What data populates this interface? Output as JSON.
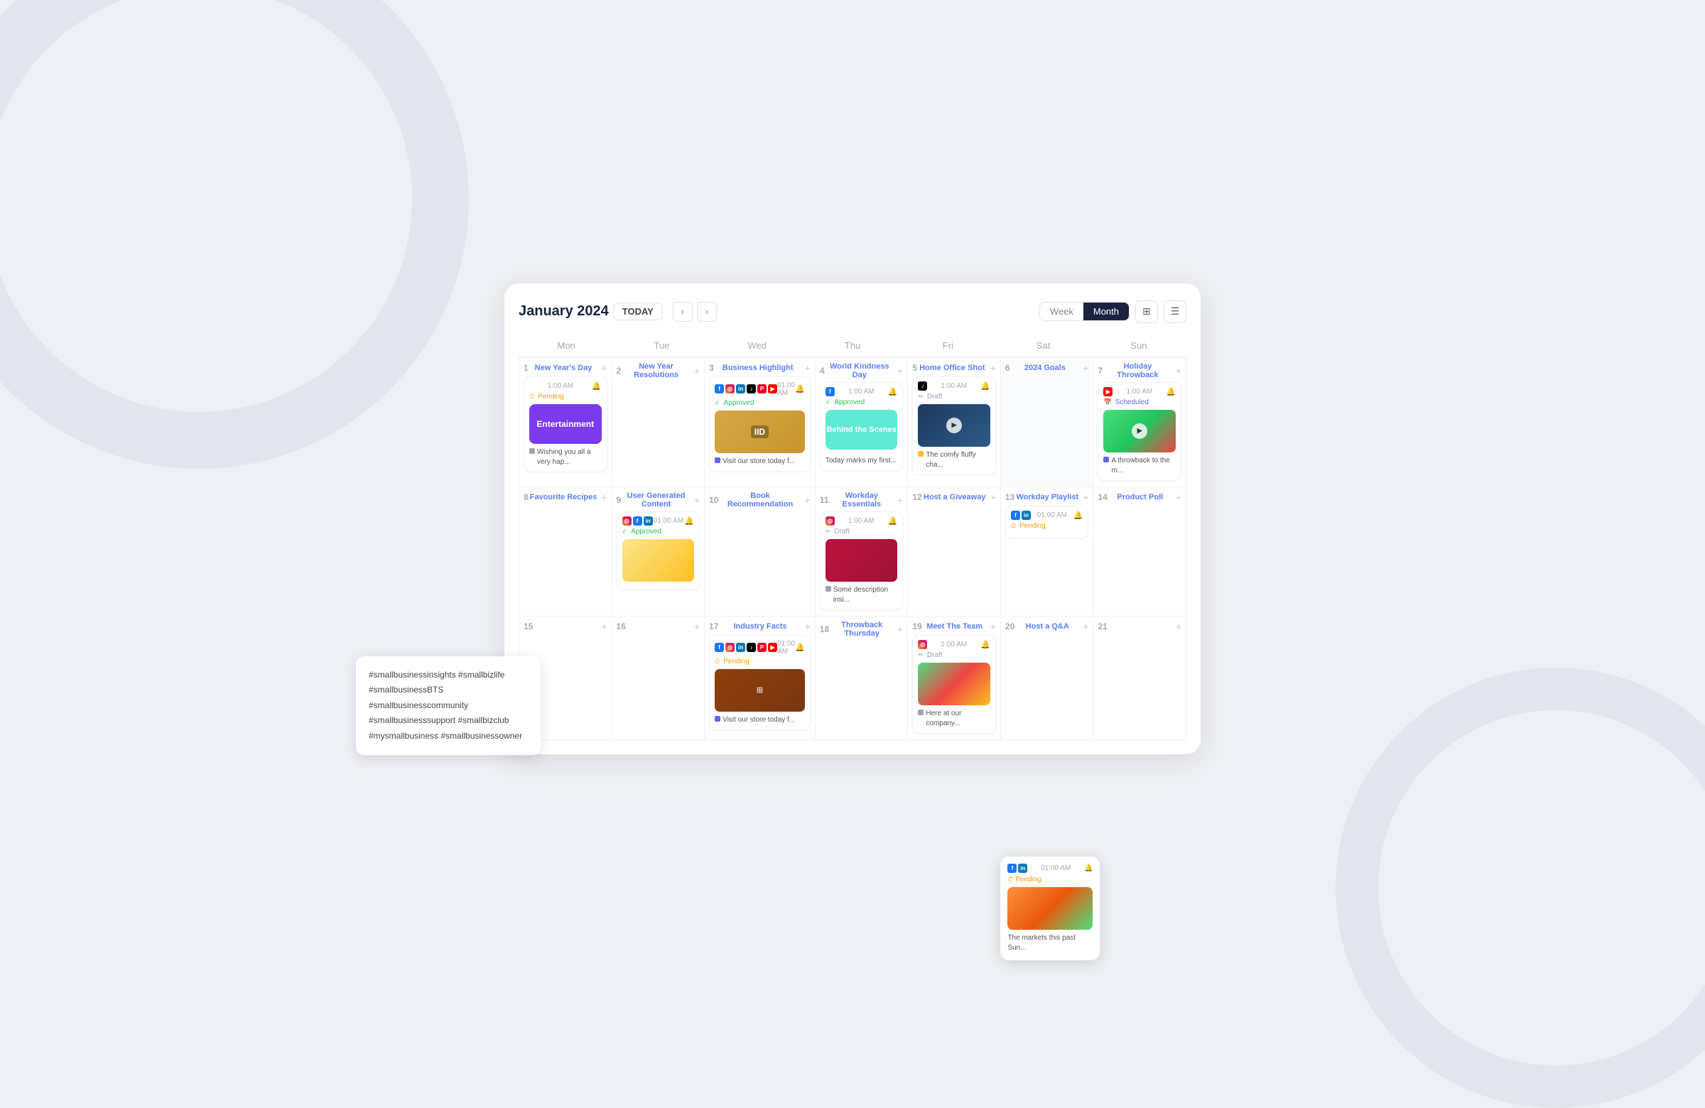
{
  "header": {
    "title": "January 2024",
    "today_btn": "TODAY",
    "week_label": "Week",
    "month_label": "Month"
  },
  "days": [
    "Mon",
    "Tue",
    "Wed",
    "Thu",
    "Fri",
    "Sat",
    "Sun"
  ],
  "view": {
    "active": "Month",
    "grid_icon": "⊞",
    "list_icon": "☰"
  },
  "rows": [
    [
      {
        "num": "1",
        "title": "New Year's Day",
        "has_card": true,
        "card_type": "pending_entertainment",
        "social_icons": [],
        "time": "1:00 AM",
        "status": "Pending",
        "status_type": "pending",
        "thumb_type": "purple",
        "thumb_label": "Entertainment",
        "desc": "Wishing you all a very hap..."
      },
      {
        "num": "2",
        "title": "New Year Resolutions",
        "has_card": false
      },
      {
        "num": "3",
        "title": "Business Highlight",
        "has_card": true,
        "social_icons": [
          "fb",
          "ig",
          "li",
          "tk",
          "pi",
          "yt"
        ],
        "time": "01:00 AM",
        "status": "Approved",
        "status_type": "approved",
        "thumb_type": "potatoes",
        "desc": "Visit our store today f..."
      },
      {
        "num": "4",
        "title": "World Kindness Day",
        "has_card": true,
        "social_icons": [
          "fb"
        ],
        "time": "1:00 AM",
        "status": "Approved",
        "status_type": "approved",
        "thumb_type": "bts",
        "desc": "Today marks my first..."
      },
      {
        "num": "5",
        "title": "Home Office Shot",
        "has_card": true,
        "social_icons": [
          "tk"
        ],
        "time": "1:00 AM",
        "status": "Draft",
        "status_type": "draft",
        "thumb_type": "blueberries",
        "desc": "The comfy fluffy cha..."
      },
      {
        "num": "6",
        "title": "2024 Goals",
        "has_card": false,
        "cell_empty": true
      },
      {
        "num": "7",
        "title": "Holiday Throwback",
        "has_card": true,
        "social_icons": [
          "yt"
        ],
        "time": "1:00 AM",
        "status": "Scheduled",
        "status_type": "scheduled",
        "thumb_type": "watermelon",
        "desc": "A throwback to the m..."
      }
    ],
    [
      {
        "num": "8",
        "title": "Favourite Recipes",
        "has_card": false,
        "has_popup": true
      },
      {
        "num": "9",
        "title": "User Generated Content",
        "has_card": true,
        "social_icons": [
          "ig",
          "fb",
          "li"
        ],
        "time": "01:00 AM",
        "status": "Approved",
        "status_type": "approved",
        "thumb_type": "lemons",
        "desc": ""
      },
      {
        "num": "10",
        "title": "Book Recommendation",
        "has_card": false
      },
      {
        "num": "11",
        "title": "Workday Essentials",
        "has_card": true,
        "social_icons": [
          "ig"
        ],
        "time": "1:00 AM",
        "status": "Draft",
        "status_type": "draft",
        "thumb_type": "pomegranate",
        "desc": "Some description insi..."
      },
      {
        "num": "12",
        "title": "Host a Giveaway",
        "has_card": false
      },
      {
        "num": "13",
        "title": "Workday Playlist",
        "has_card": true,
        "has_expanded_popup": true,
        "social_icons": [
          "fb",
          "li"
        ],
        "time": "01:00 AM",
        "status": "Pending",
        "status_type": "pending",
        "thumb_type": "oranges",
        "desc": "The markets this past Sun..."
      },
      {
        "num": "14",
        "title": "Product Poll",
        "has_card": false
      }
    ],
    [
      {
        "num": "15",
        "title": "",
        "has_card": false
      },
      {
        "num": "16",
        "title": "",
        "has_card": false
      },
      {
        "num": "17",
        "title": "Industry Facts",
        "has_card": true,
        "social_icons": [
          "fb",
          "ig",
          "li",
          "tk",
          "pi",
          "yt"
        ],
        "time": "01:00 AM",
        "status": "Pending",
        "status_type": "pending",
        "thumb_type": "beans",
        "desc": "Visit our store today f..."
      },
      {
        "num": "18",
        "title": "Throwback Thursday",
        "has_card": false
      },
      {
        "num": "19",
        "title": "Meet The Team",
        "has_card": true,
        "social_icons": [
          "ig"
        ],
        "time": "1:00 AM",
        "status": "Draft",
        "status_type": "draft",
        "thumb_type": "watermelon2",
        "desc": "Here at our company..."
      },
      {
        "num": "20",
        "title": "Host a Q&A",
        "has_card": false
      },
      {
        "num": "21",
        "title": "",
        "has_card": false
      }
    ]
  ],
  "hashtag_popup": {
    "lines": [
      "#smallbusinessinsights #smallbizlife",
      "#smallbusinessBTS #smallbusinesscommunity",
      "#smallbusinesssupport #smallbizclub",
      "#mysmallbusiness #smallbusinessowner"
    ]
  },
  "expanded_popup": {
    "social_icons": [
      "fb",
      "li"
    ],
    "time": "01:00 AM",
    "status": "Pending",
    "status_type": "pending",
    "thumb_type": "oranges",
    "text": "The markets this past Sun..."
  }
}
